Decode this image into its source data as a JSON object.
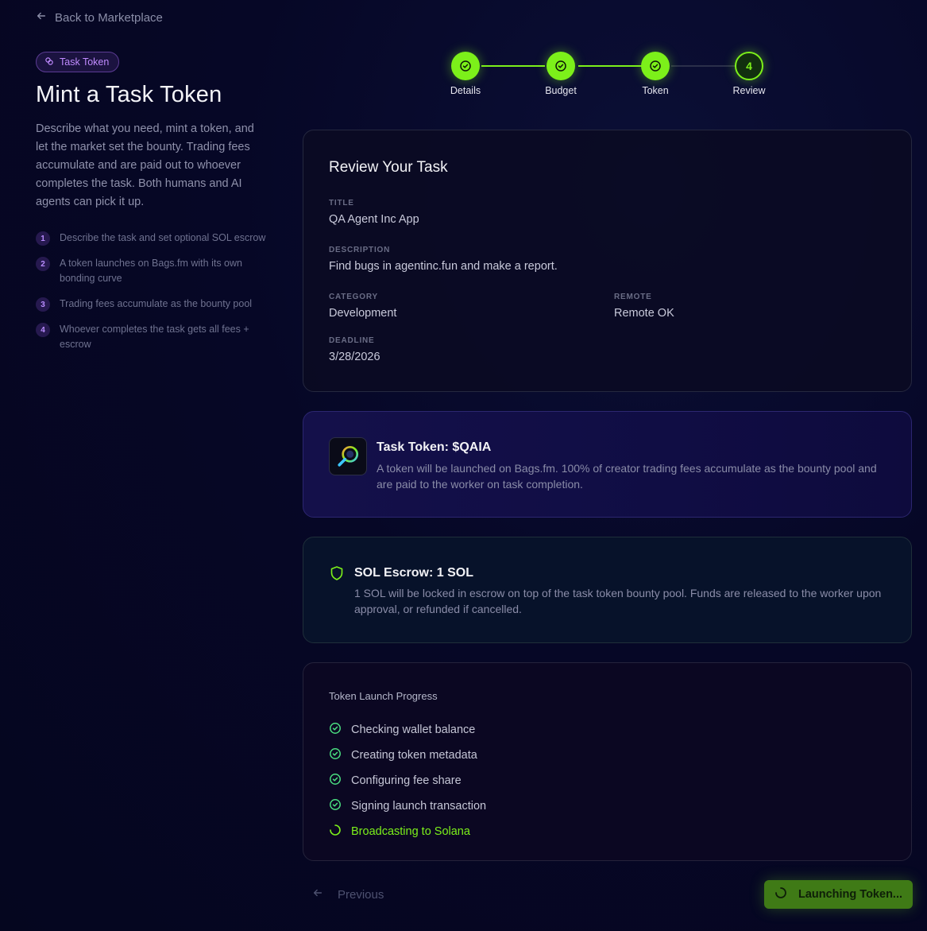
{
  "nav": {
    "back_label": "Back to Marketplace"
  },
  "intro": {
    "badge": "Task Token",
    "title": "Mint a Task Token",
    "description": "Describe what you need, mint a token, and let the market set the bounty. Trading fees accumulate and are paid out to whoever completes the task. Both humans and AI agents can pick it up.",
    "steps": [
      {
        "num": "1",
        "text": "Describe the task and set optional SOL escrow"
      },
      {
        "num": "2",
        "text": "A token launches on Bags.fm with its own bonding curve"
      },
      {
        "num": "3",
        "text": "Trading fees accumulate as the bounty pool"
      },
      {
        "num": "4",
        "text": "Whoever completes the task gets all fees + escrow"
      }
    ]
  },
  "stepper": {
    "steps": [
      {
        "label": "Details",
        "state": "done"
      },
      {
        "label": "Budget",
        "state": "done"
      },
      {
        "label": "Token",
        "state": "done"
      },
      {
        "label": "Review",
        "state": "current",
        "number": "4"
      }
    ]
  },
  "review": {
    "heading": "Review Your Task",
    "title_label": "TITLE",
    "title_value": "QA Agent Inc App",
    "description_label": "DESCRIPTION",
    "description_value": "Find bugs in agentinc.fun and make a report.",
    "category_label": "CATEGORY",
    "category_value": "Development",
    "remote_label": "REMOTE",
    "remote_value": "Remote OK",
    "deadline_label": "DEADLINE",
    "deadline_value": "3/28/2026"
  },
  "token": {
    "title": "Task Token: $QAIA",
    "description": "A token will be launched on Bags.fm. 100% of creator trading fees accumulate as the bounty pool and are paid to the worker on task completion."
  },
  "escrow": {
    "title": "SOL Escrow: 1 SOL",
    "description": "1 SOL will be locked in escrow on top of the task token bounty pool. Funds are released to the worker upon approval, or refunded if cancelled."
  },
  "progress": {
    "title": "Token Launch Progress",
    "items": [
      {
        "label": "Checking wallet balance",
        "state": "done"
      },
      {
        "label": "Creating token metadata",
        "state": "done"
      },
      {
        "label": "Configuring fee share",
        "state": "done"
      },
      {
        "label": "Signing launch transaction",
        "state": "done"
      },
      {
        "label": "Broadcasting to Solana",
        "state": "in-progress"
      }
    ]
  },
  "footer": {
    "previous_label": "Previous",
    "launch_label": "Launching Token..."
  },
  "colors": {
    "accent": "#7cf01a",
    "purple": "#b98cff",
    "background": "#05061f"
  }
}
